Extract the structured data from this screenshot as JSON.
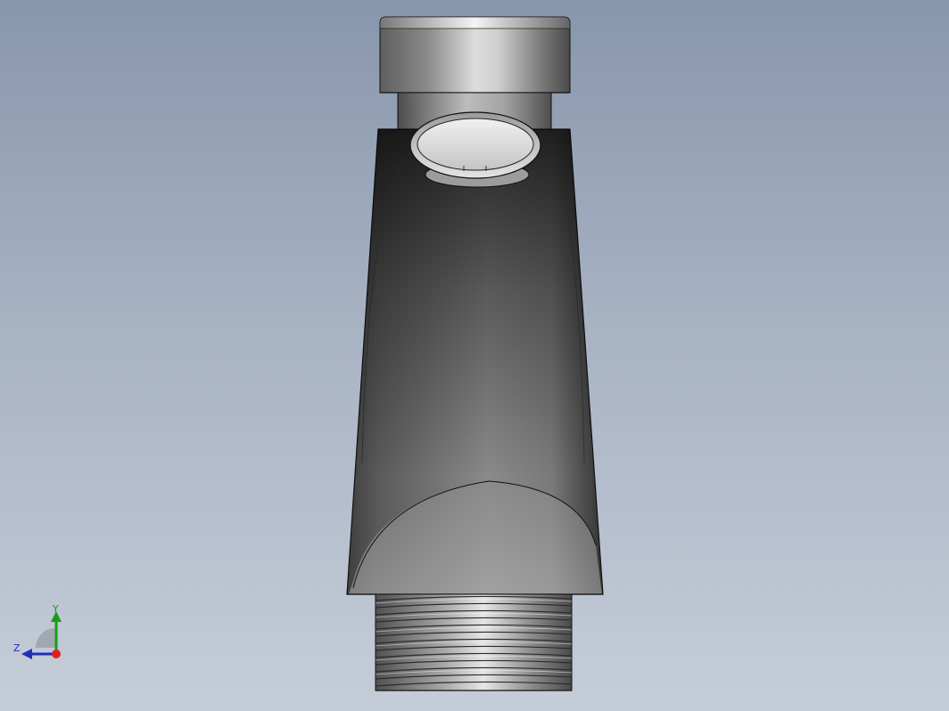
{
  "viewport": {
    "background_top": "#8896ac",
    "background_bottom": "#c5cdd8"
  },
  "model": {
    "part": "faucet-spout-with-threaded-base",
    "body_color": "#6e6e6e",
    "button_color": "#d8d8d8",
    "edge_color": "#000000"
  },
  "triad": {
    "y_label": "Y",
    "z_label": "Z",
    "y_color": "#1a9c1a",
    "z_color": "#1e2fb8",
    "x_color": "#e02020"
  }
}
